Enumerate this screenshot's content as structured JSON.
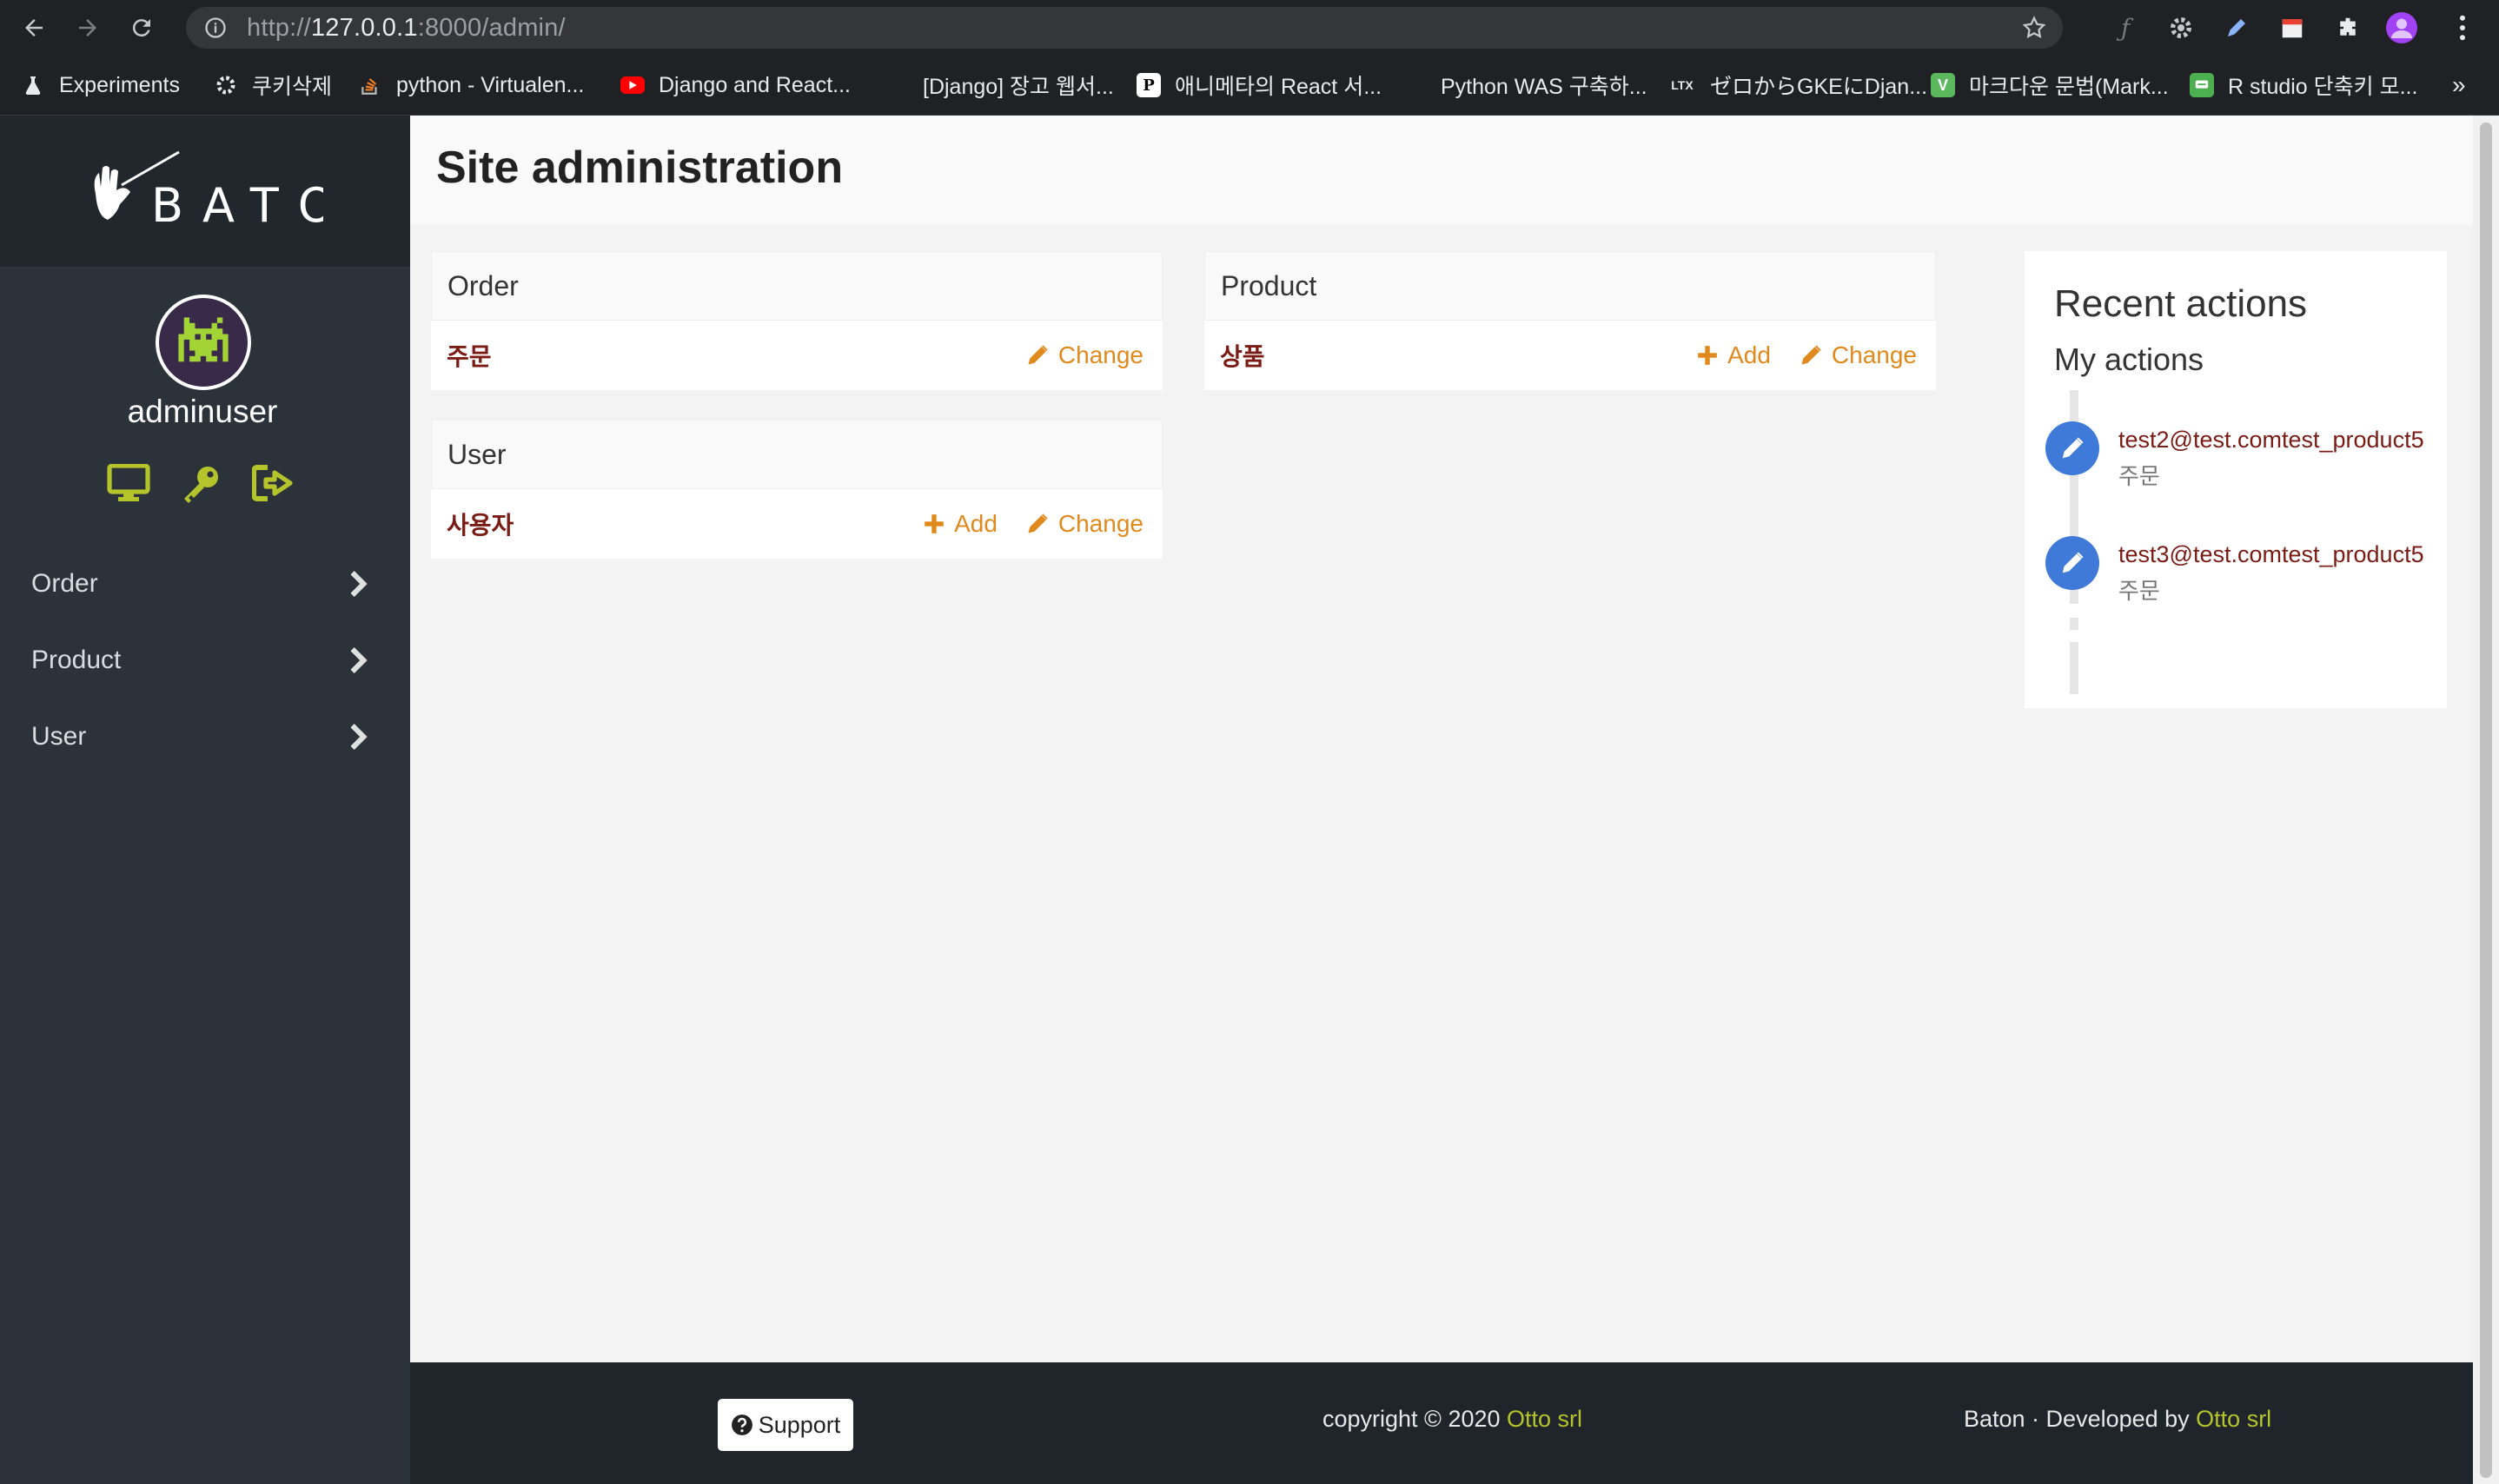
{
  "browser": {
    "url_scheme": "http://",
    "url_host": "127.0.0.1",
    "url_rest": ":8000/admin/",
    "bookmarks": [
      {
        "label": "Experiments",
        "icon": "flask-icon"
      },
      {
        "label": "쿠키삭제",
        "icon": "gear-icon"
      },
      {
        "label": "python - Virtualen...",
        "icon": "stackoverflow-icon"
      },
      {
        "label": "Django and React...",
        "icon": "youtube-icon"
      },
      {
        "label": "[Django] 장고 웹서...",
        "icon": "blank-icon"
      },
      {
        "label": "애니메타의 React 서...",
        "icon": "p-icon"
      },
      {
        "label": "Python WAS 구축하...",
        "icon": "blank-icon"
      },
      {
        "label": "ゼロからGKEにDjan...",
        "icon": "ltx-icon"
      },
      {
        "label": "마크다운 문법(Mark...",
        "icon": "v-icon"
      },
      {
        "label": "R studio 단축키 모...",
        "icon": "chat-icon"
      }
    ],
    "overflow": "»",
    "p_glyph": "P",
    "ltx_glyph": "LTX",
    "v_glyph": "V"
  },
  "sidebar": {
    "username": "adminuser",
    "menu": [
      {
        "label": "Order"
      },
      {
        "label": "Product"
      },
      {
        "label": "User"
      }
    ]
  },
  "main": {
    "title": "Site administration",
    "modules": [
      {
        "app": "Order",
        "model": "주문",
        "add_label": "",
        "change_label": "Change"
      },
      {
        "app": "User",
        "model": "사용자",
        "add_label": "Add",
        "change_label": "Change"
      },
      {
        "app": "Product",
        "model": "상품",
        "add_label": "Add",
        "change_label": "Change"
      }
    ],
    "recent": {
      "title": "Recent actions",
      "subtitle": "My actions",
      "items": [
        {
          "object": "test2@test.comtest_product5",
          "type": "주문"
        },
        {
          "object": "test3@test.comtest_product5",
          "type": "주문"
        }
      ]
    }
  },
  "footer": {
    "support_label": "Support",
    "copyright_prefix": "copyright © 2020 ",
    "company": "Otto srl",
    "dev_prefix": "Baton · Developed by ",
    "dev_company": "Otto srl"
  },
  "colors": {
    "sidebar_bg": "#2b323a",
    "accent_lime": "#b6c42c",
    "link_maroon": "#7a1b14",
    "action_orange": "#e08a1e",
    "timeline_blue": "#3f7ad9"
  }
}
